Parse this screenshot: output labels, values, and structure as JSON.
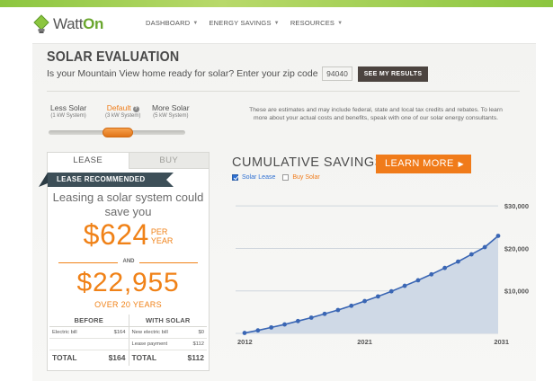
{
  "header": {
    "logo_text_prefix": "Watt",
    "logo_text_suffix": "On",
    "nav": [
      {
        "label": "DASHBOARD",
        "icon": "chevron-down-icon"
      },
      {
        "label": "ENERGY SAVINGS",
        "icon": "chevron-down-icon"
      },
      {
        "label": "RESOURCES",
        "icon": "chevron-down-icon"
      }
    ]
  },
  "page": {
    "title": "SOLAR EVALUATION",
    "question": "Is your Mountain View home ready for solar? Enter your zip code",
    "zip_value": "94040",
    "results_button": "SEE MY RESULTS"
  },
  "system": {
    "options": [
      {
        "label": "Less Solar",
        "sub": "(1 kW System)"
      },
      {
        "label": "Default",
        "sub": "(3 kW System)",
        "selected": true
      },
      {
        "label": "More Solar",
        "sub": "(5 kW System)"
      }
    ],
    "help_icon": "?",
    "disclaimer": "These are estimates and may include federal, state and local tax credits and rebates. To learn more about your actual costs and benefits, speak with one of our solar energy consultants."
  },
  "card": {
    "tabs": [
      "LEASE",
      "BUY"
    ],
    "active_tab": "LEASE",
    "ribbon": "LEASE RECOMMENDED",
    "save_text": "Leasing a solar system could save you",
    "per_year_amount": "$624",
    "per_label": "PER",
    "year_label": "YEAR",
    "and_label": "AND",
    "total_amount": "$22,955",
    "over_years": "OVER 20 YEARS",
    "table": {
      "before_header": "BEFORE",
      "with_header": "WITH SOLAR",
      "rows": [
        {
          "before_label": "Electric bill",
          "before_value": "$164",
          "with_label": "New electric bill",
          "with_value": "$0"
        },
        {
          "before_label": "",
          "before_value": "",
          "with_label": "Lease payment",
          "with_value": "$112"
        }
      ],
      "total_label": "TOTAL",
      "before_total": "$164",
      "with_total": "$112"
    }
  },
  "chart_panel": {
    "title": "CUMULATIVE SAVINGS",
    "learn_button": "LEARN MORE",
    "learn_arrow": "▶",
    "legend": [
      {
        "label": "Solar Lease",
        "checked": true
      },
      {
        "label": "Buy Solar",
        "checked": false
      }
    ]
  },
  "chart_data": {
    "type": "area",
    "title": "CUMULATIVE SAVINGS",
    "xlabel": "",
    "ylabel": "",
    "x": [
      2012,
      2013,
      2014,
      2015,
      2016,
      2017,
      2018,
      2019,
      2020,
      2021,
      2022,
      2023,
      2024,
      2025,
      2026,
      2027,
      2028,
      2029,
      2030,
      2031
    ],
    "x_ticks": [
      "2012",
      "2021",
      "2031"
    ],
    "ylim": [
      0,
      33000
    ],
    "y_ticks": [
      "$10,000",
      "$20,000",
      "$30,000"
    ],
    "y_tick_values": [
      10000,
      20000,
      30000
    ],
    "series": [
      {
        "name": "Solar Lease",
        "color": "#3a66b4",
        "fill": "#cfd9e6",
        "values": [
          100,
          700,
          1400,
          2100,
          2900,
          3700,
          4600,
          5500,
          6500,
          7600,
          8700,
          9900,
          11200,
          12500,
          13900,
          15400,
          16900,
          18600,
          20300,
          22955
        ]
      }
    ],
    "grid": true,
    "legend_position": "top-left"
  }
}
